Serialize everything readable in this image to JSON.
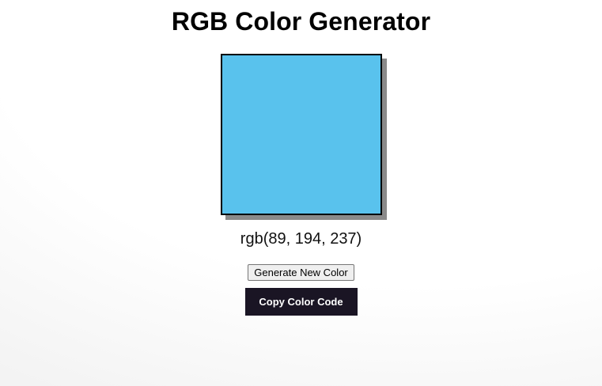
{
  "header": {
    "title": "RGB Color Generator"
  },
  "swatch": {
    "color": "#59c2ed"
  },
  "color_code": {
    "text": "rgb(89, 194, 237)"
  },
  "actions": {
    "generate_label": "Generate New Color",
    "copy_label": "Copy Color Code"
  },
  "colors": {
    "copy_button_bg": "#1a1524",
    "swatch_shadow": "#8a8a8a"
  }
}
